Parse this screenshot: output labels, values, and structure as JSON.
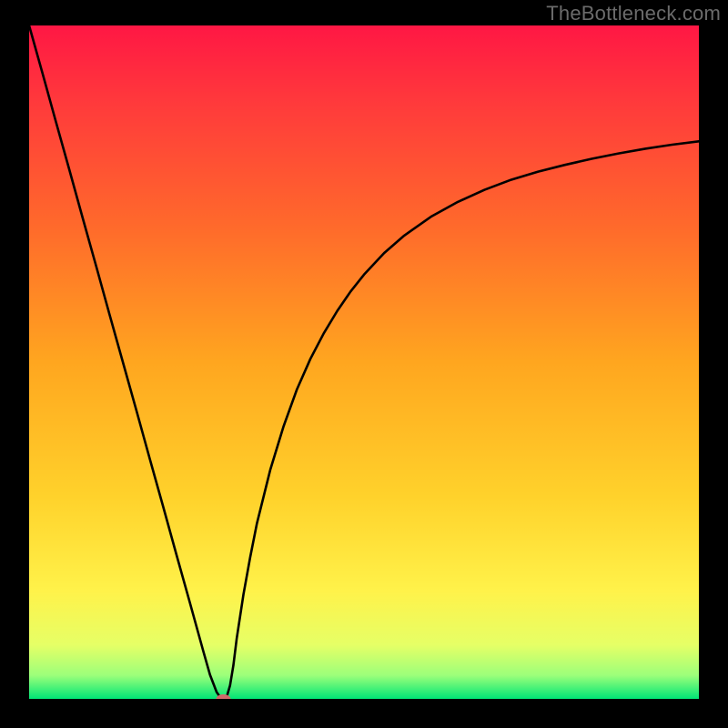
{
  "watermark": "TheBottleneck.com",
  "chart_data": {
    "type": "line",
    "title": "",
    "xlabel": "",
    "ylabel": "",
    "xlim": [
      0,
      100
    ],
    "ylim": [
      0,
      100
    ],
    "grid": false,
    "background_gradient": {
      "stops": [
        {
          "offset": 0.0,
          "color": "#ff1744"
        },
        {
          "offset": 0.12,
          "color": "#ff3b3b"
        },
        {
          "offset": 0.3,
          "color": "#ff6a2b"
        },
        {
          "offset": 0.5,
          "color": "#ffa61f"
        },
        {
          "offset": 0.7,
          "color": "#ffd22b"
        },
        {
          "offset": 0.84,
          "color": "#fff24a"
        },
        {
          "offset": 0.92,
          "color": "#e6ff66"
        },
        {
          "offset": 0.965,
          "color": "#9cff7a"
        },
        {
          "offset": 1.0,
          "color": "#00e676"
        }
      ]
    },
    "series": [
      {
        "name": "bottleneck-curve",
        "color": "#000000",
        "x": [
          0,
          2,
          4,
          6,
          8,
          10,
          12,
          14,
          16,
          18,
          20,
          22,
          24,
          26,
          27,
          28,
          28.5,
          29,
          29.5,
          30,
          30.5,
          31,
          32,
          33,
          34,
          36,
          38,
          40,
          42,
          44,
          46,
          48,
          50,
          53,
          56,
          60,
          64,
          68,
          72,
          76,
          80,
          84,
          88,
          92,
          96,
          100
        ],
        "y": [
          100,
          92.9,
          85.7,
          78.6,
          71.4,
          64.3,
          57.1,
          50.0,
          42.9,
          35.7,
          28.6,
          21.4,
          14.3,
          7.1,
          3.6,
          1.0,
          0.3,
          0.0,
          0.3,
          2.0,
          5.0,
          9.0,
          15.5,
          21.0,
          26.0,
          34.0,
          40.5,
          46.0,
          50.5,
          54.3,
          57.6,
          60.5,
          63.0,
          66.2,
          68.8,
          71.6,
          73.8,
          75.6,
          77.1,
          78.3,
          79.3,
          80.2,
          81.0,
          81.7,
          82.3,
          82.8
        ]
      }
    ],
    "marker": {
      "name": "minimum-marker",
      "x": 29,
      "y": 0,
      "color": "#d06a6a",
      "rx": 8,
      "ry": 5
    }
  }
}
